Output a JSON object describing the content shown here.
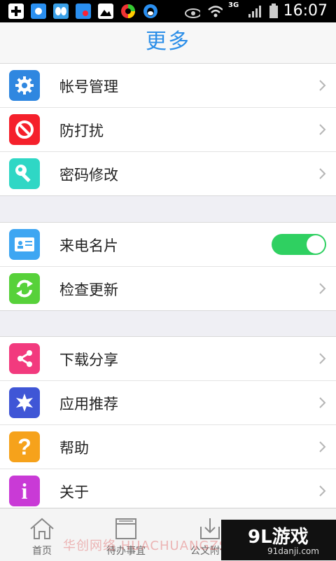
{
  "status_bar": {
    "time": "16:07",
    "network": "3G",
    "icons": [
      "add-icon",
      "app-icon",
      "butterfly-icon",
      "app-badge-icon",
      "image-icon",
      "circle-app-icon",
      "qq-icon",
      "eye-icon",
      "wifi-icon",
      "signal-icon",
      "battery-icon"
    ]
  },
  "header": {
    "title": "更多"
  },
  "groups": [
    [
      {
        "label": "帐号管理",
        "icon": "gear-icon",
        "color": "#2f87e0"
      },
      {
        "label": "防打扰",
        "icon": "block-icon",
        "color": "#f5202b"
      },
      {
        "label": "密码修改",
        "icon": "key-icon",
        "color": "#2fd7c5"
      }
    ],
    [
      {
        "label": "来电名片",
        "icon": "id-card-icon",
        "color": "#3ea6f2",
        "toggle": true
      },
      {
        "label": "检查更新",
        "icon": "refresh-icon",
        "color": "#57d13a"
      }
    ],
    [
      {
        "label": "下载分享",
        "icon": "share-icon",
        "color": "#f23a7e"
      },
      {
        "label": "应用推荐",
        "icon": "star-badge-icon",
        "color": "#3f56d6"
      },
      {
        "label": "帮助",
        "icon": "help-icon",
        "color": "#f6a21b"
      },
      {
        "label": "关于",
        "icon": "info-icon",
        "color": "#c93ad6"
      }
    ]
  ],
  "tab_bar": {
    "tabs": [
      {
        "label": "首页",
        "icon": "home-icon"
      },
      {
        "label": "待办事宜",
        "icon": "inbox-icon"
      },
      {
        "label": "公文附件",
        "icon": "download-icon"
      }
    ]
  },
  "overlay": {
    "watermark": "华创网络 HUACHUANGZS.COM",
    "brand_main": "9L游戏",
    "brand_sub": "91danji.com"
  },
  "colors": {
    "accent": "#2b8ee8",
    "toggle_on": "#2fd061"
  }
}
